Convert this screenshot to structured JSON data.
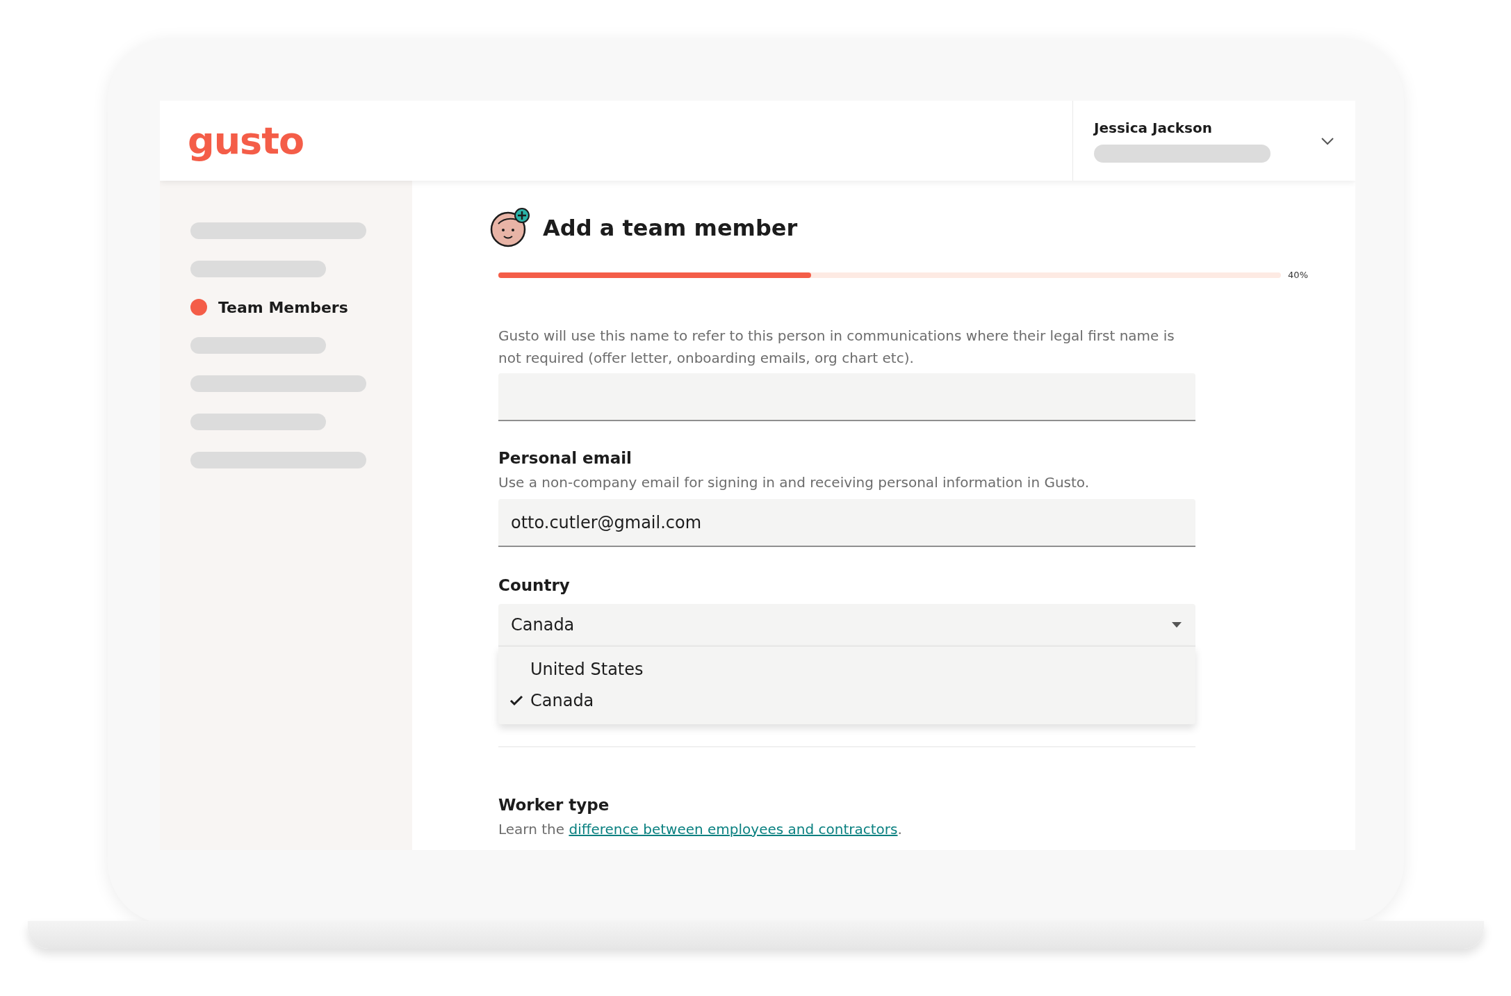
{
  "header": {
    "logo": "gusto",
    "user": {
      "name": "Jessica Jackson"
    }
  },
  "sidebar": {
    "items": [
      {
        "kind": "longbar",
        "selected": false
      },
      {
        "kind": "shortbar",
        "selected": false
      },
      {
        "kind": "link",
        "label": "Team Members",
        "selected": true
      },
      {
        "kind": "shortbar",
        "selected": false
      },
      {
        "kind": "longbar",
        "selected": false
      },
      {
        "kind": "shortbar",
        "selected": false
      },
      {
        "kind": "longbar",
        "selected": false
      }
    ]
  },
  "form": {
    "title": "Add a team member",
    "progress": {
      "level": 0.4,
      "label": "40%"
    },
    "preferred_name": {
      "hint": "Gusto will use this name to refer to this person in communications where their legal first name is not required (offer letter, onboarding emails, org chart etc)."
    },
    "personal_email": {
      "label": "Personal email",
      "hint": "Use a non-company email for signing in and receiving personal information in Gusto.",
      "value": "otto.cutler@gmail.com"
    },
    "country": {
      "label": "Country",
      "value": "Canada",
      "expanded": true,
      "options": [
        {
          "label": "United States",
          "selected": false
        },
        {
          "label": "Canada",
          "selected": true
        }
      ]
    },
    "worker_type": {
      "label": "Worker type",
      "text_before": "Learn the",
      "link": "difference between employees and contractors",
      "text_after": "."
    }
  }
}
